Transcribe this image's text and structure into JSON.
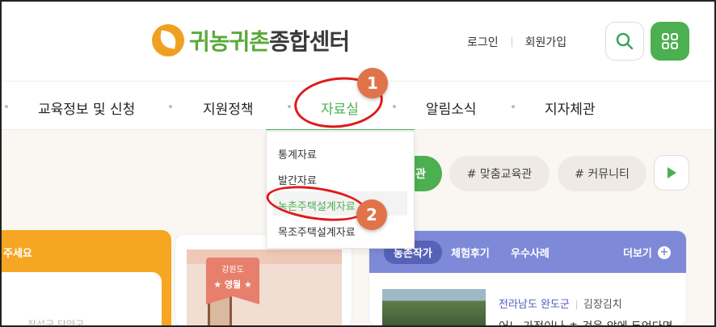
{
  "header": {
    "logo": {
      "part1": "귀농귀촌",
      "part2": "종합센터"
    },
    "links": {
      "login": "로그인",
      "signup": "회원가입"
    },
    "icons": {
      "search": "search-icon",
      "menu": "grid-menu-icon"
    },
    "colors": {
      "brand_green": "#4caf50",
      "brand_orange": "#f0a020"
    }
  },
  "nav": {
    "items": [
      "교육정보 및 신청",
      "지원정책",
      "자료실",
      "알림소식",
      "지자체관"
    ]
  },
  "dropdown": {
    "items": [
      "통계자료",
      "발간자료",
      "농촌주택설계자료",
      "목조주택설계자료"
    ]
  },
  "tags": {
    "first": "관",
    "second": "# 맞춤교육관",
    "third": "# 커뮤니티"
  },
  "orange_card": {
    "title": "주세요",
    "stamp": "장성군 단양군"
  },
  "photo_card": {
    "region": "강원도",
    "name": "★ 영월 ★"
  },
  "news_card": {
    "tabs": [
      "농촌작가",
      "체험후기",
      "우수사례"
    ],
    "more": "더보기",
    "region": "전라남도 완도군",
    "category": "김장김치",
    "snippet": "어느 가정이나 ㅊ 것을 앞에 두었다면"
  },
  "annotations": {
    "first": "1",
    "second": "2"
  }
}
